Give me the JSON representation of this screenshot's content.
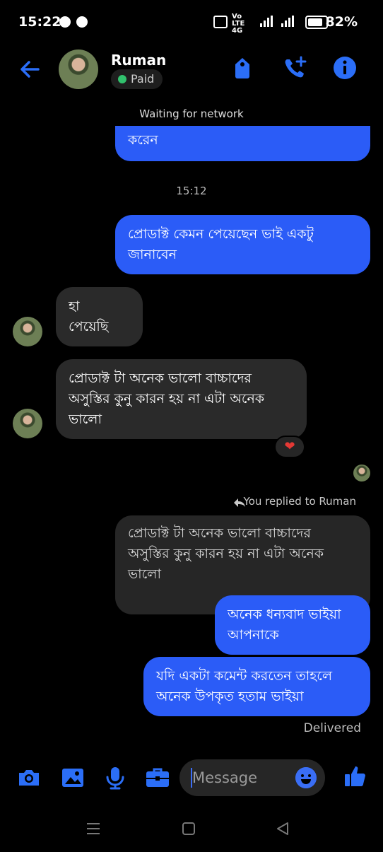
{
  "status_bar": {
    "time": "15:22",
    "network_labels": "Vo LTE 4G",
    "battery": "82%"
  },
  "header": {
    "contact_name": "Ruman",
    "badge": "Paid"
  },
  "network_notice": "Waiting for network",
  "messages": {
    "partial_top": "করেন",
    "timestamp": "15:12",
    "m1": "প্রোডাক্ট কেমন পেয়েছেন ভাই একটু\nজানাবেন",
    "r1": "হা\nপেয়েছি",
    "r2": "প্রোডাক্ট টা অনেক ভালো বাচ্চাদের\nঅসুস্তির কুনু কারন হয় না এটা অনেক\nভালো",
    "reaction": "❤",
    "replied_label": "You replied to Ruman",
    "quoted": "প্রোডাক্ট টা অনেক ভালো বাচ্চাদের\nঅসুস্তির কুনু কারন হয় না এটা অনেক\nভালো",
    "m2": "অনেক ধন্যবাদ ভাইয়া\nআপনাকে",
    "m3": "যদি একটা কমেন্ট করতেন তাহলে\nঅনেক উপকৃত হতাম ভাইয়া",
    "delivered": "Delivered"
  },
  "composer": {
    "placeholder": "Message"
  },
  "icons": {
    "accent": "#2b5cf7",
    "header": [
      "back-arrow-icon",
      "tag-icon",
      "add-call-icon",
      "info-icon"
    ],
    "composer": [
      "camera-icon",
      "gallery-icon",
      "mic-icon",
      "briefcase-icon",
      "emoji-icon",
      "thumbs-up-icon"
    ],
    "nav": [
      "menu-icon",
      "home-icon",
      "back-icon"
    ]
  }
}
